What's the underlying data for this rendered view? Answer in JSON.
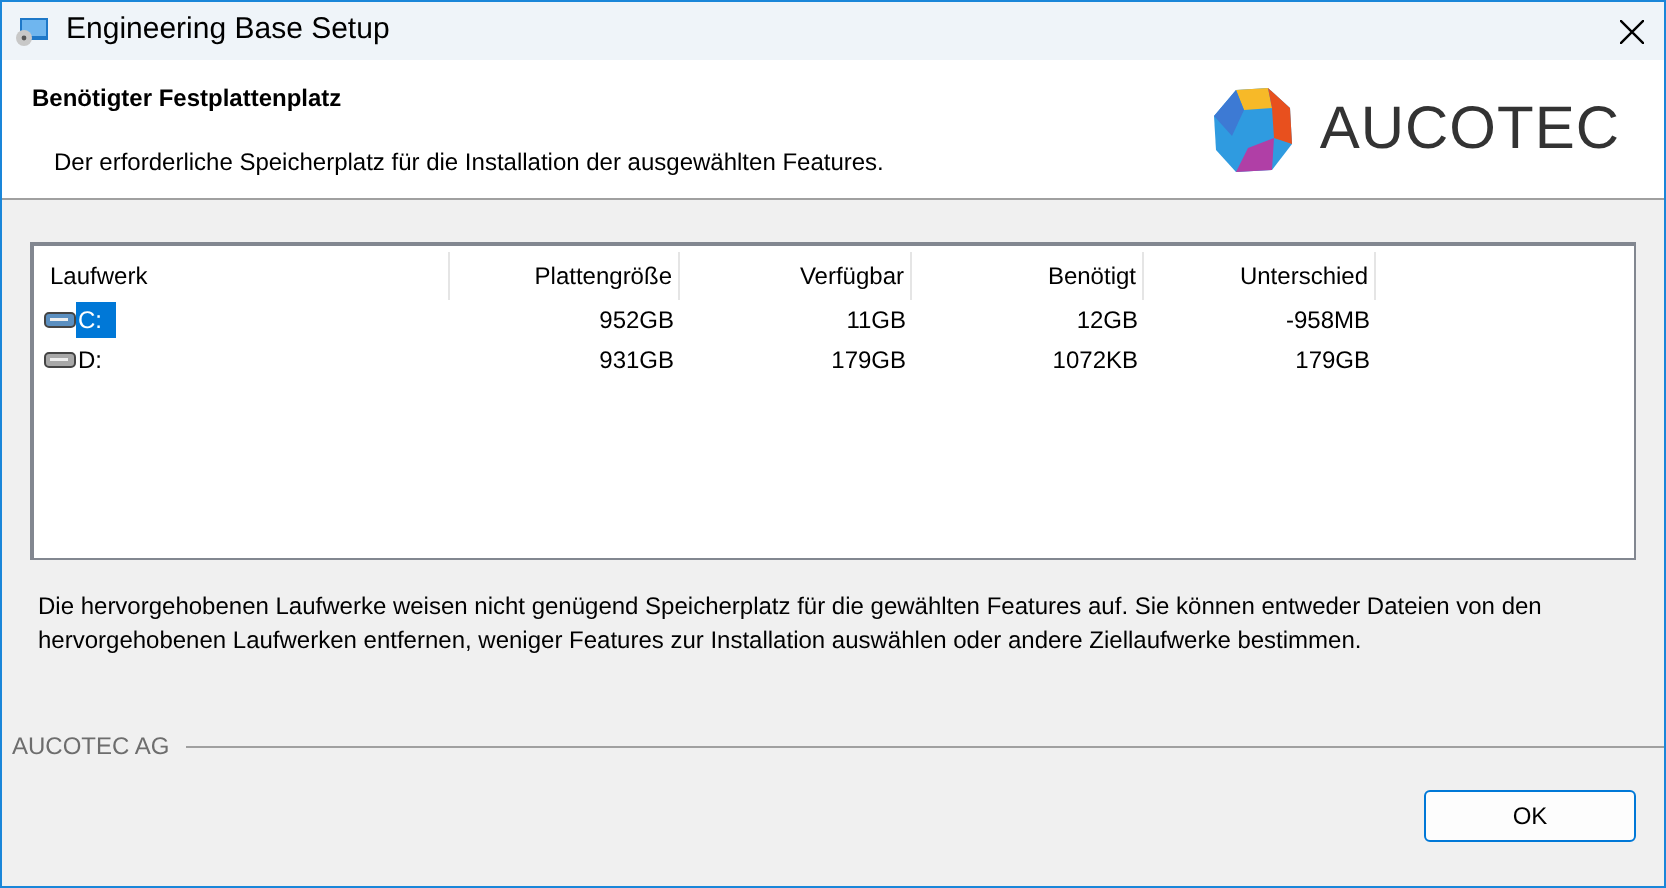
{
  "window": {
    "title": "Engineering Base Setup"
  },
  "header": {
    "title": "Benötigter Festplattenplatz",
    "description": "Der erforderliche Speicherplatz für die Installation der ausgewählten Features.",
    "logo_text": "AUCOTEC"
  },
  "table": {
    "columns": [
      "Laufwerk",
      "Plattengröße",
      "Verfügbar",
      "Benötigt",
      "Unterschied"
    ],
    "rows": [
      {
        "selected": true,
        "cells": [
          "C:",
          "952GB",
          "11GB",
          "12GB",
          "-958MB"
        ]
      },
      {
        "selected": false,
        "cells": [
          "D:",
          "931GB",
          "179GB",
          "1072KB",
          "179GB"
        ]
      }
    ]
  },
  "message": "Die hervorgehobenen Laufwerke weisen nicht genügend Speicherplatz für die gewählten Features auf. Sie können entweder Dateien von den hervorgehobenen Laufwerken entfernen, weniger Features zur Installation auswählen oder andere Ziellaufwerke bestimmen.",
  "footer": {
    "brand": "AUCOTEC AG",
    "buttons": [
      "OK"
    ]
  }
}
